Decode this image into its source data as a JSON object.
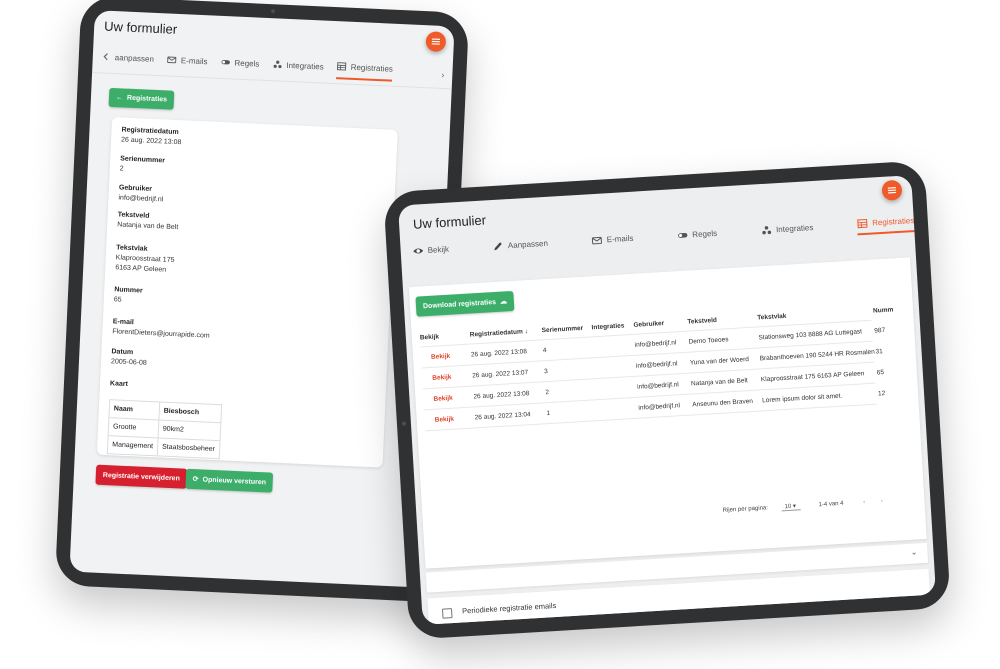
{
  "back_tablet": {
    "title": "Uw formulier",
    "tabs": [
      {
        "label": "aanpassen",
        "icon": "chevron-left-icon"
      },
      {
        "label": "E-mails",
        "icon": "mail-icon"
      },
      {
        "label": "Regels",
        "icon": "toggle-icon"
      },
      {
        "label": "Integraties",
        "icon": "integrations-icon"
      },
      {
        "label": "Registraties",
        "icon": "table-icon"
      }
    ],
    "back_button": "Registraties",
    "fields": [
      {
        "label": "Registratiedatum",
        "value": "26 aug. 2022 13:08"
      },
      {
        "label": "Serienummer",
        "value": "2"
      },
      {
        "label": "Gebruiker",
        "value": "info@bedrijf.nl"
      },
      {
        "label": "Tekstveld",
        "value": "Natanja van de Belt"
      },
      {
        "label": "Tekstvlak",
        "value": "Klaproosstraat 175",
        "value2": "6163 AP Geleen"
      },
      {
        "label": "Nummer",
        "value": "65"
      },
      {
        "label": "E-mail",
        "value": "FlorentDieters@jourrapide.com"
      },
      {
        "label": "Datum",
        "value": "2005-06-08"
      }
    ],
    "kaart": {
      "label": "Kaart",
      "rows": [
        [
          "Naam",
          "Biesbosch"
        ],
        [
          "Grootte",
          "90km2"
        ],
        [
          "Management",
          "Staatsbosbeheer"
        ]
      ]
    },
    "delete_button": "Registratie verwijderen",
    "resend_button": "Opnieuw versturen"
  },
  "front_tablet": {
    "title": "Uw formulier",
    "tabs": [
      {
        "label": "Bekijk",
        "icon": "eye-icon"
      },
      {
        "label": "Aanpassen",
        "icon": "pencil-icon"
      },
      {
        "label": "E-mails",
        "icon": "mail-icon"
      },
      {
        "label": "Regels",
        "icon": "toggle-icon"
      },
      {
        "label": "Integraties",
        "icon": "integrations-icon"
      },
      {
        "label": "Registraties",
        "icon": "table-icon"
      }
    ],
    "download_button": "Download registraties",
    "headers": [
      "Bekijk",
      "Registratiedatum ↓",
      "Serienummer",
      "Integraties",
      "Gebruiker",
      "Tekstveld",
      "Tekstvlak",
      "Numm"
    ],
    "rows": [
      {
        "link": "Bekijk",
        "date": "26 aug. 2022 13:08",
        "serial": "4",
        "user": "info@bedrijf.nl",
        "text": "Demo Toeoes",
        "area": "Stationsweg 103 8888 AG Luttegast",
        "num": "987"
      },
      {
        "link": "Bekijk",
        "date": "26 aug. 2022 13:07",
        "serial": "3",
        "user": "info@bedrijf.nl",
        "text": "Yuna van der Woerd",
        "area": "Brabanthoeven 190 5244 HR Rosmalen",
        "num": "31"
      },
      {
        "link": "Bekijk",
        "date": "26 aug. 2022 13:08",
        "serial": "2",
        "user": "info@bedrijf.nl",
        "text": "Natanja van de Belt",
        "area": "Klaproosstraat 175 6163 AP Geleen",
        "num": "65"
      },
      {
        "link": "Bekijk",
        "date": "26 aug. 2022 13:04",
        "serial": "1",
        "user": "info@bedrijf.nl",
        "text": "Anseunu den Braven",
        "area": "Lorem ipsum dolor sit amet.",
        "num": "12"
      }
    ],
    "rows_per_page_label": "Rijen per pagina:",
    "rows_per_page_value": "10",
    "range": "1-4 van 4",
    "periodic_label": "Periodieke registratie emails"
  },
  "colors": {
    "accent": "#f05a28",
    "green": "#3dae6a",
    "red": "#d6202f",
    "link": "#e0452a"
  }
}
